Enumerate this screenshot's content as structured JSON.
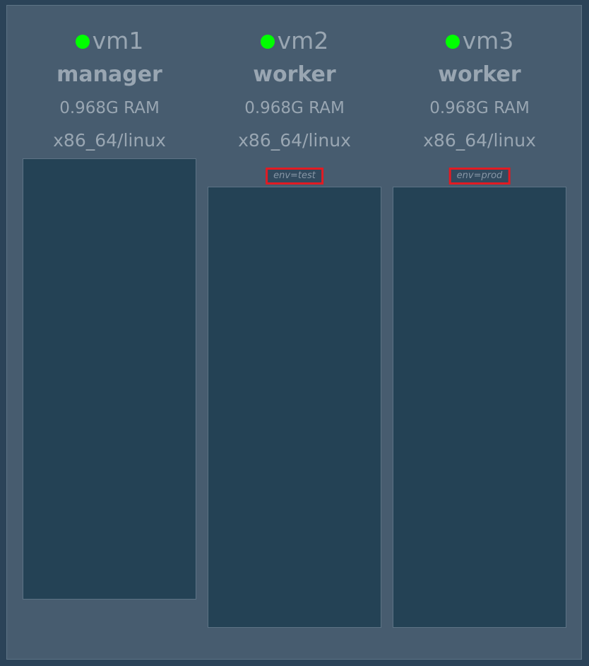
{
  "nodes": [
    {
      "name": "vm1",
      "status_color": "#00ff00",
      "role": "manager",
      "ram": "0.968G RAM",
      "platform": "x86_64/linux",
      "label": ""
    },
    {
      "name": "vm2",
      "status_color": "#00ff00",
      "role": "worker",
      "ram": "0.968G RAM",
      "platform": "x86_64/linux",
      "label": "env=test"
    },
    {
      "name": "vm3",
      "status_color": "#00ff00",
      "role": "worker",
      "ram": "0.968G RAM",
      "platform": "x86_64/linux",
      "label": "env=prod"
    }
  ],
  "colors": {
    "background": "#2b4358",
    "panel": "#475c6f",
    "task_area": "#244255",
    "text": "#99a6b2",
    "label_border": "#e21b23",
    "status_ok": "#00ff00"
  }
}
